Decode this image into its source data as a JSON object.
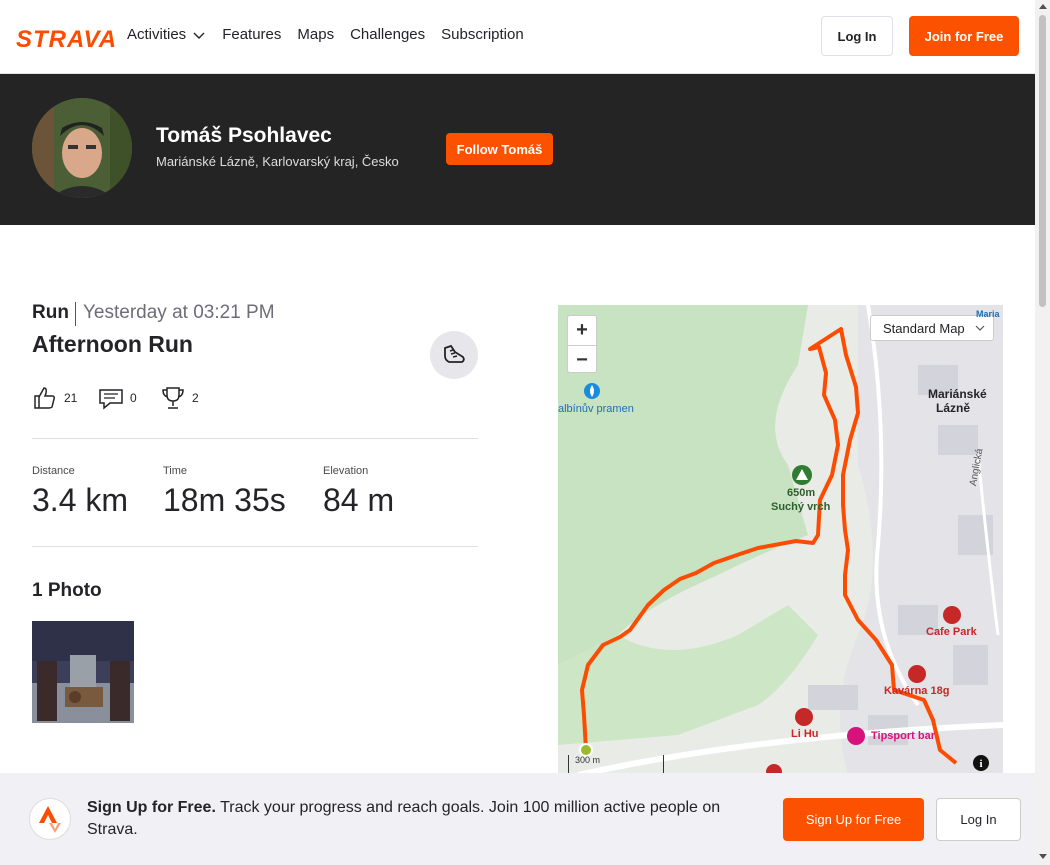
{
  "nav": {
    "logo": "STRAVA",
    "links": [
      "Activities",
      "Features",
      "Maps",
      "Challenges",
      "Subscription"
    ],
    "login": "Log In",
    "join": "Join for Free"
  },
  "athlete": {
    "name": "Tomáš Psohlavec",
    "location": "Mariánské Lázně, Karlovarský kraj, Česko",
    "follow": "Follow Tomáš"
  },
  "activity": {
    "type": "Run",
    "date": "Yesterday at 03:21 PM",
    "title": "Afternoon Run",
    "kudos": "21",
    "comments": "0",
    "achievements": "2",
    "stats": [
      {
        "label": "Distance",
        "value": "3.4 km"
      },
      {
        "label": "Time",
        "value": "18m 35s"
      },
      {
        "label": "Elevation",
        "value": "84 m"
      }
    ],
    "photos_title": "1 Photo"
  },
  "map": {
    "zoom_in": "+",
    "zoom_out": "−",
    "map_type": "Standard Map",
    "labels": {
      "town": "Mariánské Lázně",
      "town_corner": "Maria",
      "spring": "albínův pramen",
      "peak_elev": "650m",
      "peak_name": "Suchý vrch",
      "street": "Anglická",
      "cafe_park": "Cafe Park",
      "kavarna": "Kavárna 18g",
      "li_hu": "Li Hu",
      "tipsport": "Tipsport bar"
    },
    "scale": "300 m"
  },
  "banner": {
    "lead": "Sign Up for Free.",
    "text": "Track your progress and reach goals. Join 100 million active people on Strava.",
    "signup": "Sign Up for Free",
    "login": "Log In"
  },
  "colors": {
    "brand": "#fc5200",
    "route": "#fc4c02",
    "band": "#242424"
  }
}
